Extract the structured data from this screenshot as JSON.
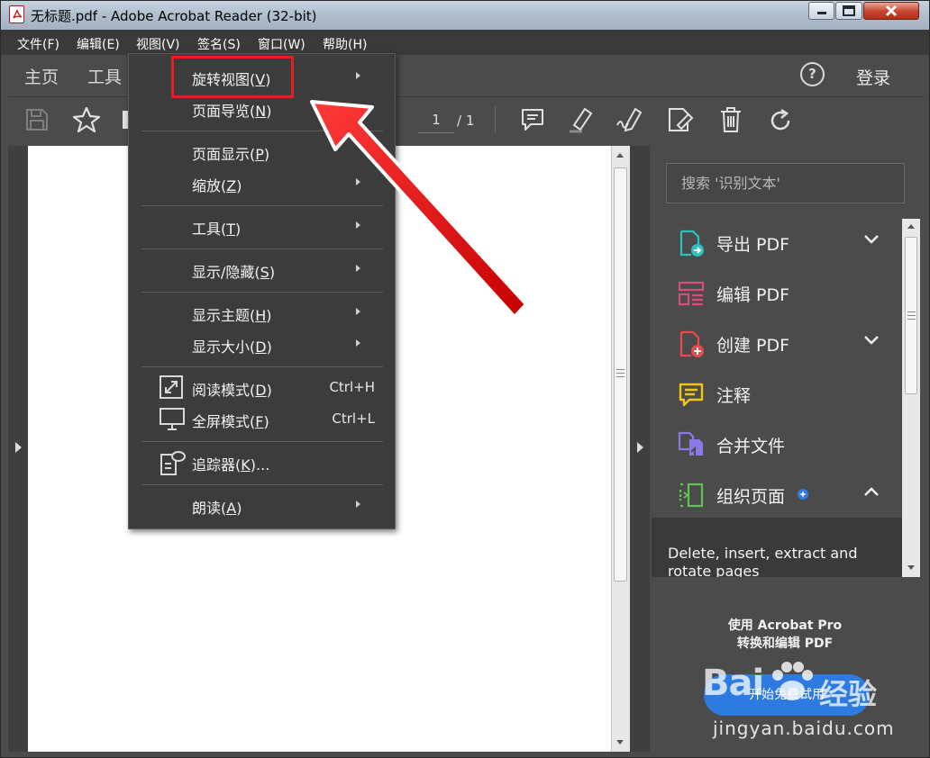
{
  "window": {
    "title": "无标题.pdf - Adobe Acrobat Reader (32-bit)"
  },
  "menubar": [
    {
      "label": "文件(F)"
    },
    {
      "label": "编辑(E)"
    },
    {
      "label": "视图(V)"
    },
    {
      "label": "签名(S)"
    },
    {
      "label": "窗口(W)"
    },
    {
      "label": "帮助(H)"
    }
  ],
  "tabs": {
    "home": "主页",
    "tools": "工具"
  },
  "header": {
    "help": "?",
    "login": "登录"
  },
  "toolbar": {
    "page_current": "1",
    "page_total": "/ 1"
  },
  "view_menu": {
    "items": [
      {
        "text": "旋转视图",
        "key": "V",
        "submenu": true,
        "shortcut": ""
      },
      {
        "text": "页面导览",
        "key": "N",
        "submenu": true,
        "shortcut": ""
      },
      {
        "text": "页面显示",
        "key": "P",
        "submenu": false,
        "shortcut": ""
      },
      {
        "text": "缩放",
        "key": "Z",
        "submenu": true,
        "shortcut": ""
      },
      {
        "text": "工具",
        "key": "T",
        "submenu": true,
        "shortcut": ""
      },
      {
        "text": "显示/隐藏",
        "key": "S",
        "submenu": true,
        "shortcut": ""
      },
      {
        "text": "显示主题",
        "key": "H",
        "submenu": true,
        "shortcut": ""
      },
      {
        "text": "显示大小",
        "key": "D",
        "submenu": true,
        "shortcut": ""
      },
      {
        "text": "阅读模式",
        "key": "D",
        "submenu": false,
        "shortcut": "Ctrl+H"
      },
      {
        "text": "全屏模式",
        "key": "F",
        "submenu": false,
        "shortcut": "Ctrl+L"
      },
      {
        "text": "追踪器",
        "key": "K",
        "suffix": "...",
        "submenu": false,
        "shortcut": ""
      },
      {
        "text": "朗读",
        "key": "A",
        "submenu": true,
        "shortcut": ""
      }
    ],
    "highlighted": "旋转视图(V)"
  },
  "right_panel": {
    "search_placeholder": "搜索 '识别文本'",
    "tools": [
      {
        "label": "导出 PDF",
        "icon": "export-pdf-icon",
        "color": "#2fbfbf",
        "chevron": "down"
      },
      {
        "label": "编辑 PDF",
        "icon": "edit-pdf-icon",
        "color": "#e0497a",
        "chevron": ""
      },
      {
        "label": "创建 PDF",
        "icon": "create-pdf-icon",
        "color": "#e74c4c",
        "chevron": "down"
      },
      {
        "label": "注释",
        "icon": "comment-icon",
        "color": "#f2c719",
        "chevron": ""
      },
      {
        "label": "合并文件",
        "icon": "combine-files-icon",
        "color": "#8b7ae6",
        "chevron": ""
      },
      {
        "label": "组织页面",
        "icon": "organize-pages-icon",
        "color": "#5bc64b",
        "chevron": "up"
      }
    ],
    "tool_description": "Delete, insert, extract and rotate pages",
    "promo_line1": "使用 Acrobat Pro",
    "promo_line2": "转换和编辑 PDF",
    "trial_button": "开始免费试用"
  },
  "watermark": {
    "brand": "Bai",
    "brand2": "经验",
    "url": "jingyan.baidu.com"
  },
  "colors": {
    "accent_blue": "#2d7be0",
    "highlight_red": "#e41e1e",
    "menu_bg": "#3c3c3c",
    "panel_bg": "#4b4b4b"
  }
}
